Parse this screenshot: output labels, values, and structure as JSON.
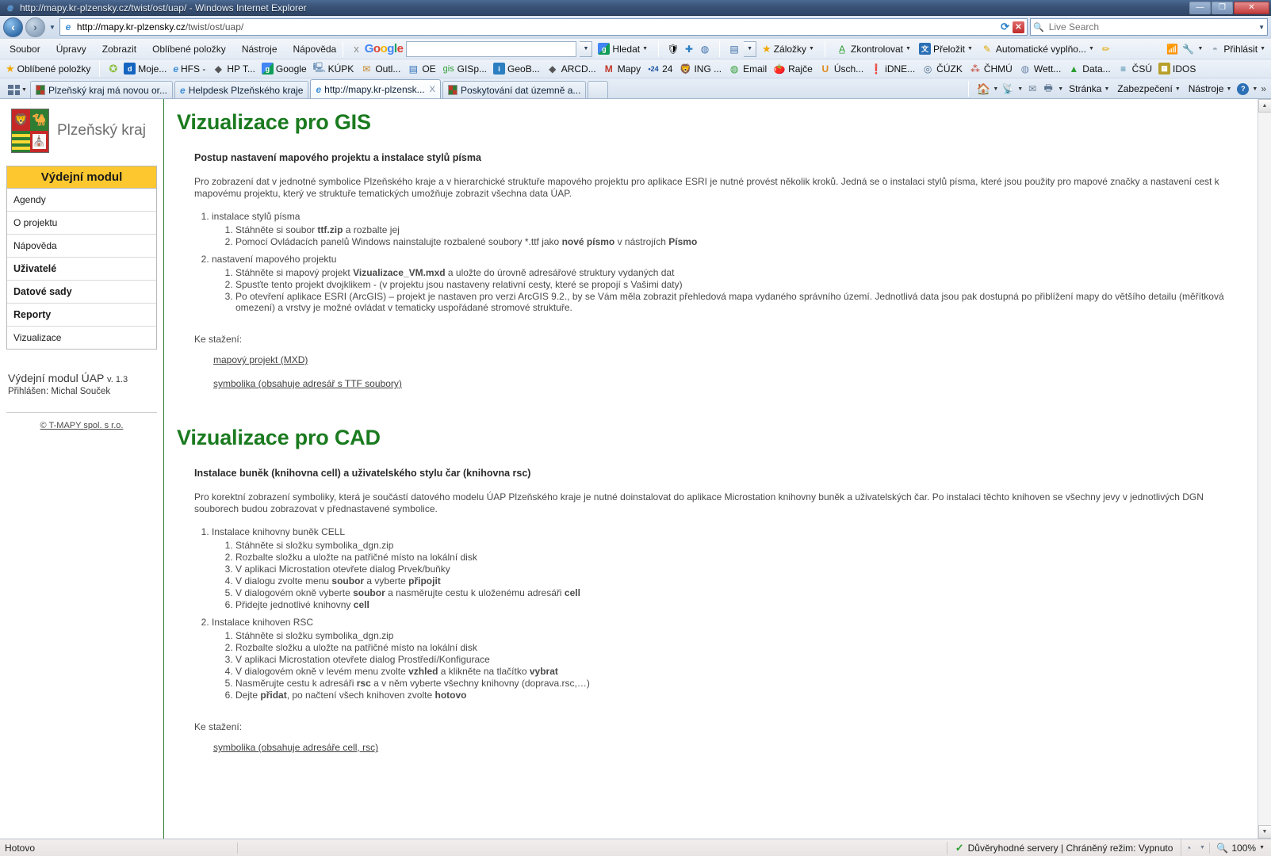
{
  "window": {
    "title": "http://mapy.kr-plzensky.cz/twist/ost/uap/ - Windows Internet Explorer",
    "minimize": "—",
    "maximize": "❐",
    "close": "✕"
  },
  "address": {
    "url_domain": "http://mapy.kr-plzensky.cz",
    "url_path": "/twist/ost/uap/",
    "search_placeholder": "Live Search",
    "search_value": ""
  },
  "menubar": {
    "items": [
      "Soubor",
      "Úpravy",
      "Zobrazit",
      "Oblíbené položky",
      "Nástroje",
      "Nápověda"
    ]
  },
  "google_toolbar": {
    "close_label": "x",
    "logo": "Google",
    "query": "",
    "search_button": "Hledat",
    "bookmarks": "Záložky",
    "spellcheck": "Zkontrolovat",
    "translate": "Přeložit",
    "autofill": "Automatické vyplňo...",
    "signin": "Přihlásit"
  },
  "links_bar": {
    "title": "Oblíbené položky",
    "items": [
      {
        "label": "Moje...",
        "icon": "d-icon",
        "color": "#1565c0"
      },
      {
        "label": "HFS -",
        "icon": "ie-icon",
        "color": "#3d8fd6"
      },
      {
        "label": "HP T...",
        "icon": "diamond-icon",
        "color": "#555555"
      },
      {
        "label": "Google",
        "icon": "google-icon",
        "color": "#4285F4"
      },
      {
        "label": "KÚPK",
        "icon": "monitor-icon",
        "color": "#6b8fb5"
      },
      {
        "label": "Outl...",
        "icon": "mail-icon",
        "color": "#c4872b"
      },
      {
        "label": "OE",
        "icon": "oe-icon",
        "color": "#2c6fbb"
      },
      {
        "label": "GISp...",
        "icon": "gis-icon",
        "color": "#2e9e32"
      },
      {
        "label": "GeoB...",
        "icon": "info-icon",
        "color": "#2b7fc1"
      },
      {
        "label": "ARCD...",
        "icon": "diamond-icon",
        "color": "#555555"
      },
      {
        "label": "Mapy",
        "icon": "m-icon",
        "color": "#c0392b"
      },
      {
        "label": "24",
        "icon": "badge24-icon",
        "color": "#1a4fa0"
      },
      {
        "label": "ING ...",
        "icon": "ing-icon",
        "color": "#d07b2a"
      },
      {
        "label": "Email",
        "icon": "globe-icon",
        "color": "#2e9e32"
      },
      {
        "label": "Rajče",
        "icon": "tomato-icon",
        "color": "#c0392b"
      },
      {
        "label": "Úsch...",
        "icon": "u-icon",
        "color": "#e08a1e"
      },
      {
        "label": "iDNE...",
        "icon": "idnes-icon",
        "color": "#c0392b"
      },
      {
        "label": "ČÚZK",
        "icon": "cuzk-icon",
        "color": "#4a6b8a"
      },
      {
        "label": "ČHMÚ",
        "icon": "chmu-icon",
        "color": "#c0392b"
      },
      {
        "label": "Wett...",
        "icon": "weather-icon",
        "color": "#6f86a8"
      },
      {
        "label": "Data...",
        "icon": "tree-icon",
        "color": "#2e9e32"
      },
      {
        "label": "ČSÚ",
        "icon": "csu-icon",
        "color": "#2e7d9e"
      },
      {
        "label": "IDOS",
        "icon": "idos-icon",
        "color": "#b8a02a"
      }
    ]
  },
  "tabs": [
    {
      "label": "Plzeňský kraj má novou or...",
      "icon": "coat-icon",
      "active": false,
      "closable": false
    },
    {
      "label": "Helpdesk Plzeňského kraje",
      "icon": "ie-icon",
      "active": false,
      "closable": false
    },
    {
      "label": "http://mapy.kr-plzensk...",
      "icon": "ie-icon",
      "active": true,
      "closable": true,
      "close": "X"
    },
    {
      "label": "Poskytování dat územně a...",
      "icon": "coat-icon",
      "active": false,
      "closable": false
    }
  ],
  "command_bar": {
    "home": "home-icon",
    "feeds": "rss-icon",
    "mail": "mail-icon",
    "print": "print-icon",
    "page": "Stránka",
    "security": "Zabezpečení",
    "tools": "Nástroje",
    "help": "help-icon",
    "overflow": "»"
  },
  "sidebar": {
    "brand": "Plzeňský kraj",
    "menu_title": "Výdejní modul",
    "items": [
      {
        "label": "Agendy",
        "bold": false
      },
      {
        "label": "O projektu",
        "bold": false
      },
      {
        "label": "Nápověda",
        "bold": false
      },
      {
        "label": "Uživatelé",
        "bold": true
      },
      {
        "label": "Datové sady",
        "bold": true
      },
      {
        "label": "Reporty",
        "bold": true
      },
      {
        "label": "Vizualizace",
        "bold": false
      }
    ],
    "app_name": "Výdejní modul ÚAP",
    "version": "v. 1.3",
    "logged_in": "Přihlášen: Michal Souček",
    "footer": "© T-MAPY spol. s r.o."
  },
  "content": {
    "gis": {
      "heading": "Vizualizace pro GIS",
      "subheading": "Postup nastavení mapového projektu a instalace stylů písma",
      "paragraph": "Pro zobrazení dat v jednotné symbolice Plzeňského kraje a v hierarchické struktuře mapového projektu pro aplikace ESRI je nutné provést několik kroků. Jedná se o instalaci stylů písma, které jsou použity pro mapové značky a nastavení cest k mapovému projektu, který ve struktuře tematických umožňuje zobrazit všechna data ÚAP.",
      "steps": [
        {
          "title": "instalace stylů písma",
          "substeps": [
            "Stáhněte si soubor <b>ttf.zip</b> a rozbalte jej",
            "Pomocí Ovládacích panelů Windows nainstalujte rozbalené soubory *.ttf jako <b>nové písmo</b> v nástrojích <b>Písmo</b>"
          ]
        },
        {
          "title": "nastavení mapového projektu",
          "substeps": [
            "Stáhněte si mapový projekt <b>Vizualizace_VM.mxd</b> a uložte do úrovně adresářové struktury vydaných dat",
            "Spusťte tento projekt dvojklikem - (v projektu jsou nastaveny relativní cesty, které se propojí s Vašimi daty)",
            "Po otevření aplikace ESRI (ArcGIS) – projekt je nastaven pro verzi ArcGIS 9.2., by se Vám měla zobrazit přehledová mapa vydaného správního území. Jednotlivá data jsou pak dostupná po přiblížení mapy do většího detailu (měřítková omezení) a vrstvy je možné ovládat v tematicky uspořádané stromové struktuře."
          ]
        }
      ],
      "download_label": "Ke stažení:",
      "downloads": [
        "mapový projekt (MXD)",
        "symbolika (obsahuje adresář s TTF soubory)"
      ]
    },
    "cad": {
      "heading": "Vizualizace pro CAD",
      "subheading": "Instalace buněk (knihovna cell) a uživatelského stylu čar (knihovna rsc)",
      "paragraph": "Pro korektní zobrazení symboliky, která je součástí datového modelu ÚAP Plzeňského kraje je nutné doinstalovat do aplikace Microstation knihovny buněk a uživatelských čar. Po instalaci těchto knihoven se všechny jevy v jednotlivých DGN souborech budou zobrazovat v přednastavené symbolice.",
      "steps": [
        {
          "title": "Instalace knihovny buněk CELL",
          "substeps": [
            "Stáhněte si složku symbolika_dgn.zip",
            "Rozbalte složku a uložte na patřičné místo na lokální disk",
            "V aplikaci Microstation otevřete dialog Prvek/buňky",
            "V dialogu zvolte menu <b>soubor</b> a vyberte <b>připojit</b>",
            "V dialogovém okně vyberte <b>soubor</b> a nasměrujte cestu k uloženému adresáři <b>cell</b>",
            "Přidejte jednotlivé knihovny <b>cell</b>"
          ]
        },
        {
          "title": "Instalace knihoven RSC",
          "substeps": [
            "Stáhněte si složku symbolika_dgn.zip",
            "Rozbalte složku a uložte na patřičné místo na lokální disk",
            "V aplikaci Microstation otevřete dialog Prostředí/Konfigurace",
            "V dialogovém okně v levém menu zvolte <b>vzhled</b> a klikněte na tlačítko <b>vybrat</b>",
            "Nasměrujte cestu k adresáři <b>rsc</b> a v něm vyberte všechny knihovny (doprava.rsc,…)",
            "Dejte <b>přidat</b>, po načtení všech knihoven zvolte <b>hotovo</b>"
          ]
        }
      ],
      "download_label": "Ke stažení:",
      "downloads": [
        "symbolika (obsahuje adresáře cell, rsc)"
      ]
    }
  },
  "statusbar": {
    "status": "Hotovo",
    "zone": "Důvěryhodné servery | Chráněný režim: Vypnuto",
    "zoom": "100%"
  },
  "colors": {
    "heading_green": "#1a7a1f",
    "menu_yellow": "#fdc82f",
    "border_green": "#2e7d32"
  }
}
